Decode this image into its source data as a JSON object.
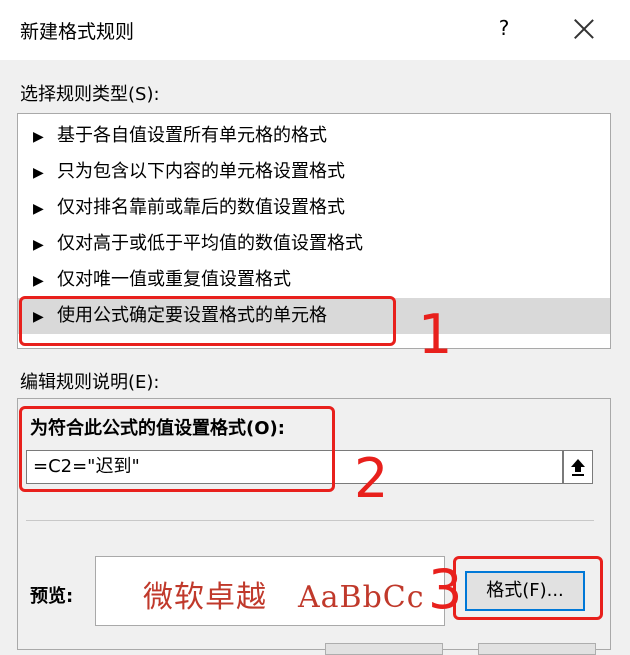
{
  "dialog": {
    "title": "新建格式规则",
    "help_glyph": "?",
    "close_label": "×"
  },
  "rule_type": {
    "label": "选择规则类型(S):",
    "items": [
      {
        "arrow": "▶",
        "label": "基于各自值设置所有单元格的格式"
      },
      {
        "arrow": "▶",
        "label": "只为包含以下内容的单元格设置格式"
      },
      {
        "arrow": "▶",
        "label": "仅对排名靠前或靠后的数值设置格式"
      },
      {
        "arrow": "▶",
        "label": "仅对高于或低于平均值的数值设置格式"
      },
      {
        "arrow": "▶",
        "label": "仅对唯一值或重复值设置格式"
      },
      {
        "arrow": "▶",
        "label": "使用公式确定要设置格式的单元格",
        "selected": true
      }
    ]
  },
  "rule_desc": {
    "label": "编辑规则说明(E):",
    "formula_label": "为符合此公式的值设置格式(O):",
    "formula_value": "=C2=\"迟到\"",
    "preview_label": "预览:",
    "preview_text": "微软卓越　AaBbCc",
    "format_button": "格式(F)..."
  },
  "annotations": {
    "color": "#e8201c",
    "numbers": [
      "1",
      "2",
      "3"
    ]
  },
  "colors": {
    "preview_text": "#c0392b",
    "focus_border": "#0078d7",
    "selected_row": "#d9d9d9"
  }
}
